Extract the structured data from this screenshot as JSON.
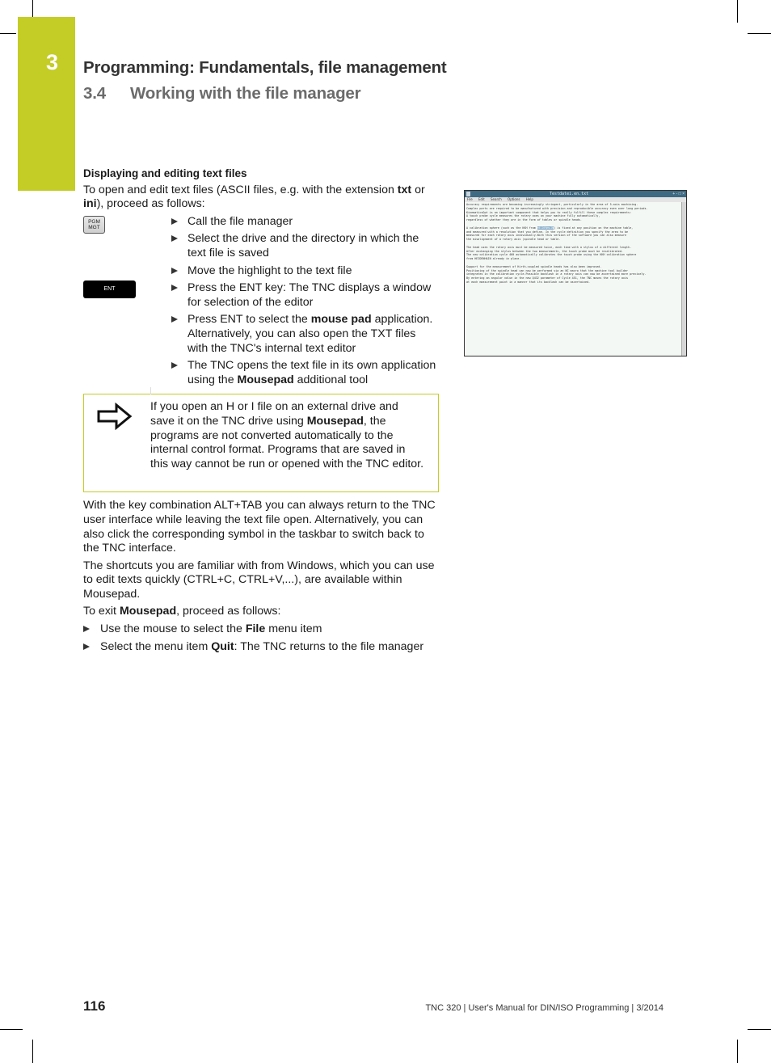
{
  "header": {
    "chapter_number": "3",
    "chapter_title": "Programming: Fundamentals, file management",
    "section_number": "3.4",
    "section_title": "Working with the file manager"
  },
  "content": {
    "subheading": "Displaying and editing text files",
    "intro_parts": [
      "To open and edit text files (ASCII files, e.g. with the extension ",
      "txt",
      " or ",
      "ini",
      "), proceed as follows:"
    ],
    "keys": {
      "pgm_mgt_line1": "PGM",
      "pgm_mgt_line2": "MGT",
      "ent": "ENT"
    },
    "steps": [
      {
        "text": "Call the file manager"
      },
      {
        "text": "Select the drive and the directory in which the text file is saved"
      },
      {
        "text": "Move the highlight to the text file"
      },
      {
        "text": "Press the ENT key: The TNC displays a window for selection of the editor"
      },
      {
        "pre": "Press ENT to select the ",
        "bold": "mouse pad",
        "post": " application. Alternatively, you can also open the TXT files with the TNC's internal text editor"
      },
      {
        "pre": "The TNC opens the text file in its own application using the ",
        "bold": "Mousepad",
        "post": " additional tool"
      }
    ],
    "note": {
      "icon": "arrow-right-icon",
      "pre": "If you open an H or I file on an external drive and save it on the TNC drive using ",
      "bold": "Mousepad",
      "post": ", the programs are not converted automatically to the internal control format. Programs that are saved in this way cannot be run or opened with the TNC editor."
    },
    "paragraphs": [
      "With the key combination ALT+TAB you can always return to the TNC user interface while leaving the text file open. Alternatively, you can also click the corresponding symbol in the taskbar to switch back to the TNC interface.",
      "The shortcuts you are familiar with from Windows, which you can use to edit texts quickly (CTRL+C, CTRL+V,...), are available within Mousepad."
    ],
    "exit_parts": [
      "To exit ",
      "Mousepad",
      ", proceed as follows:"
    ],
    "exit_steps": [
      {
        "pre": "Use the mouse to select the ",
        "bold": "File",
        "post": " menu item"
      },
      {
        "pre": "Select the menu item ",
        "bold": "Quit",
        "post": ": The TNC returns to the file manager"
      }
    ]
  },
  "screenshot": {
    "window_title": "Testdatei.en.txt",
    "window_buttons": "+ - □ ×",
    "menu": [
      "File",
      "Edit",
      "Search",
      "Options",
      "Help"
    ],
    "lines": [
      "Accuracy requirements are becoming increasingly stringent, particularly in the area of 5-axis machining.",
      "Complex parts are required to be manufactured with precision and reproducible accuracy even over long periods.",
      "KinematicsOpt is an important component that helps you to really fulfill these complex requirements:",
      "A touch probe cycle measures the rotary axes on your machine fully automatically,",
      "regardless of whether they are in the form of tables or spindle heads.",
      "",
      "A calibration sphere (such as the KKH from HEIDENHAIN) is fixed at any position on the machine table,",
      "and measured with a resolution that you define. In the cycle definition you specify the area to be",
      "measured for each rotary axis individually.With this version of the software you can also measure",
      "the misalignment of a rotary axis (spindle head or table.",
      "",
      "The head uses the rotary axis must be measured twice, each time with a stylus of a different length.",
      "After exchanging the stylus between the two measurements, the touch probe must be recalibrated.",
      "The new calibration cycle 460 automatically calibrates the touch probe using the KKH calibration sphere",
      "from HEIDENHAIN already in place.",
      "",
      "Support for the measurement of Hirth-coupled spindle heads has also been improved.",
      "Positioning of the spindle head can now be performed via an NC macro that the machine tool builder",
      "integrates in the calibration cycle.Possible backlash in a rotary axis can now be ascertained more precisely.",
      "By entering an angular value in the new Q432 parameter of Cycle 451, the TNC moves the rotary axis",
      "at each measurement point in a manner that its backlash can be ascertained."
    ],
    "highlighted_word": "HEIDENHAIN"
  },
  "footer": {
    "page_number": "116",
    "text": "TNC 320 | User's Manual for DIN/ISO Programming | 3/2014"
  }
}
